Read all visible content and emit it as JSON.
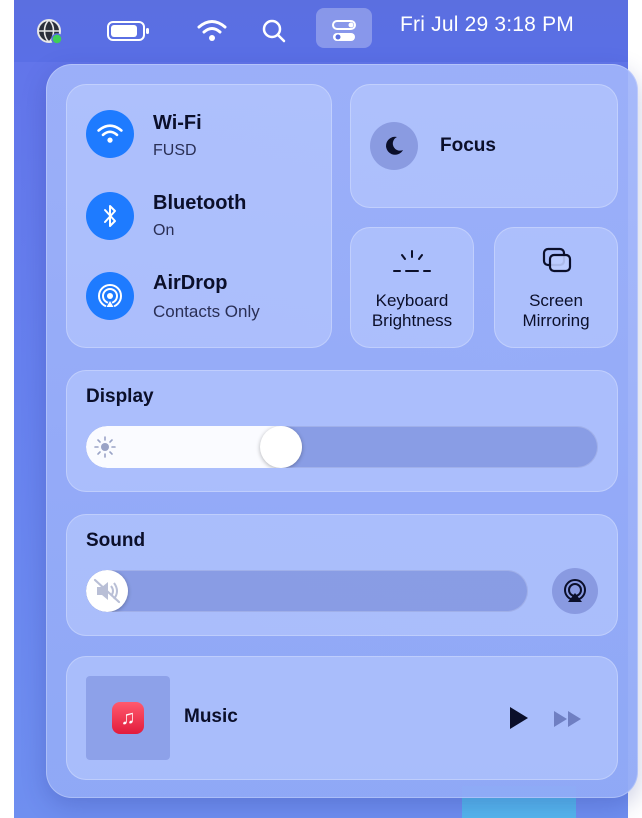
{
  "menubar": {
    "clock": "Fri Jul 29  3:18 PM",
    "icons": [
      "globe-status-icon",
      "battery-icon",
      "wifi-icon",
      "spotlight-search-icon",
      "control-center-icon"
    ]
  },
  "connectivity": {
    "wifi": {
      "title": "Wi-Fi",
      "status": "FUSD"
    },
    "bluetooth": {
      "title": "Bluetooth",
      "status": "On"
    },
    "airdrop": {
      "title": "AirDrop",
      "status": "Contacts Only"
    }
  },
  "focus": {
    "title": "Focus"
  },
  "keyboard_brightness": {
    "line1": "Keyboard",
    "line2": "Brightness"
  },
  "screen_mirroring": {
    "line1": "Screen",
    "line2": "Mirroring"
  },
  "display": {
    "title": "Display",
    "level": 0.37
  },
  "sound": {
    "title": "Sound",
    "level": 0.0
  },
  "now_playing": {
    "app": "Music"
  },
  "colors": {
    "accent": "#1e7bff",
    "music": "#e21b3c"
  }
}
